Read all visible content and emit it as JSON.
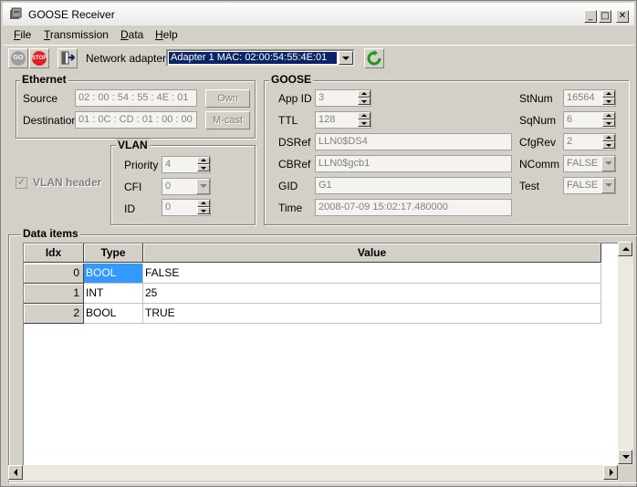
{
  "window": {
    "title": "GOOSE Receiver"
  },
  "menu": [
    "File",
    "Transmission",
    "Data",
    "Help"
  ],
  "toolbar": {
    "go_label": "GO",
    "stop_label": "STOP",
    "network_adapter_label": "Network adapter",
    "adapter_value": "Adapter 1 MAC: 02:00:54:55:4E:01"
  },
  "ethernet": {
    "title": "Ethernet",
    "source_label": "Source",
    "source_value": "02 : 00 : 54 : 55 : 4E : 01",
    "own_button": "Own",
    "destination_label": "Destination",
    "destination_value": "01 : 0C : CD : 01 : 00 : 00",
    "mcast_button": "M-cast"
  },
  "vlan": {
    "title": "VLAN",
    "header_checkbox_label": "VLAN header",
    "header_checked": true,
    "priority_label": "Priority",
    "priority_value": "4",
    "cfi_label": "CFI",
    "cfi_value": "0",
    "id_label": "ID",
    "id_value": "0"
  },
  "goose": {
    "title": "GOOSE",
    "appid_label": "App ID",
    "appid_value": "3",
    "ttl_label": "TTL",
    "ttl_value": "128",
    "dsref_label": "DSRef",
    "dsref_value": "LLN0$DS4",
    "cbref_label": "CBRef",
    "cbref_value": "LLN0$gcb1",
    "gid_label": "GID",
    "gid_value": "G1",
    "time_label": "Time",
    "time_value": "2008-07-09 15:02:17.480000",
    "stnum_label": "StNum",
    "stnum_value": "16564",
    "sqnum_label": "SqNum",
    "sqnum_value": "6",
    "cfgrev_label": "CfgRev",
    "cfgrev_value": "2",
    "ncomm_label": "NComm",
    "ncomm_value": "FALSE",
    "test_label": "Test",
    "test_value": "FALSE"
  },
  "data_items": {
    "title": "Data items",
    "columns": [
      "Idx",
      "Type",
      "Value"
    ],
    "rows": [
      {
        "idx": "0",
        "type": "BOOL",
        "value": "FALSE",
        "selected": true
      },
      {
        "idx": "1",
        "type": "INT",
        "value": "25"
      },
      {
        "idx": "2",
        "type": "BOOL",
        "value": "TRUE"
      }
    ]
  },
  "colors": {
    "selection": "#0a246a",
    "cell_selection": "#3399ff",
    "face": "#d4d0c8",
    "go_icon": "#9e9e9e",
    "stop_icon": "#e02020",
    "refresh_icon": "#1a9a1a"
  },
  "icons": {
    "title": "app-icon",
    "exit": "exit-door-icon",
    "refresh": "refresh-icon"
  }
}
